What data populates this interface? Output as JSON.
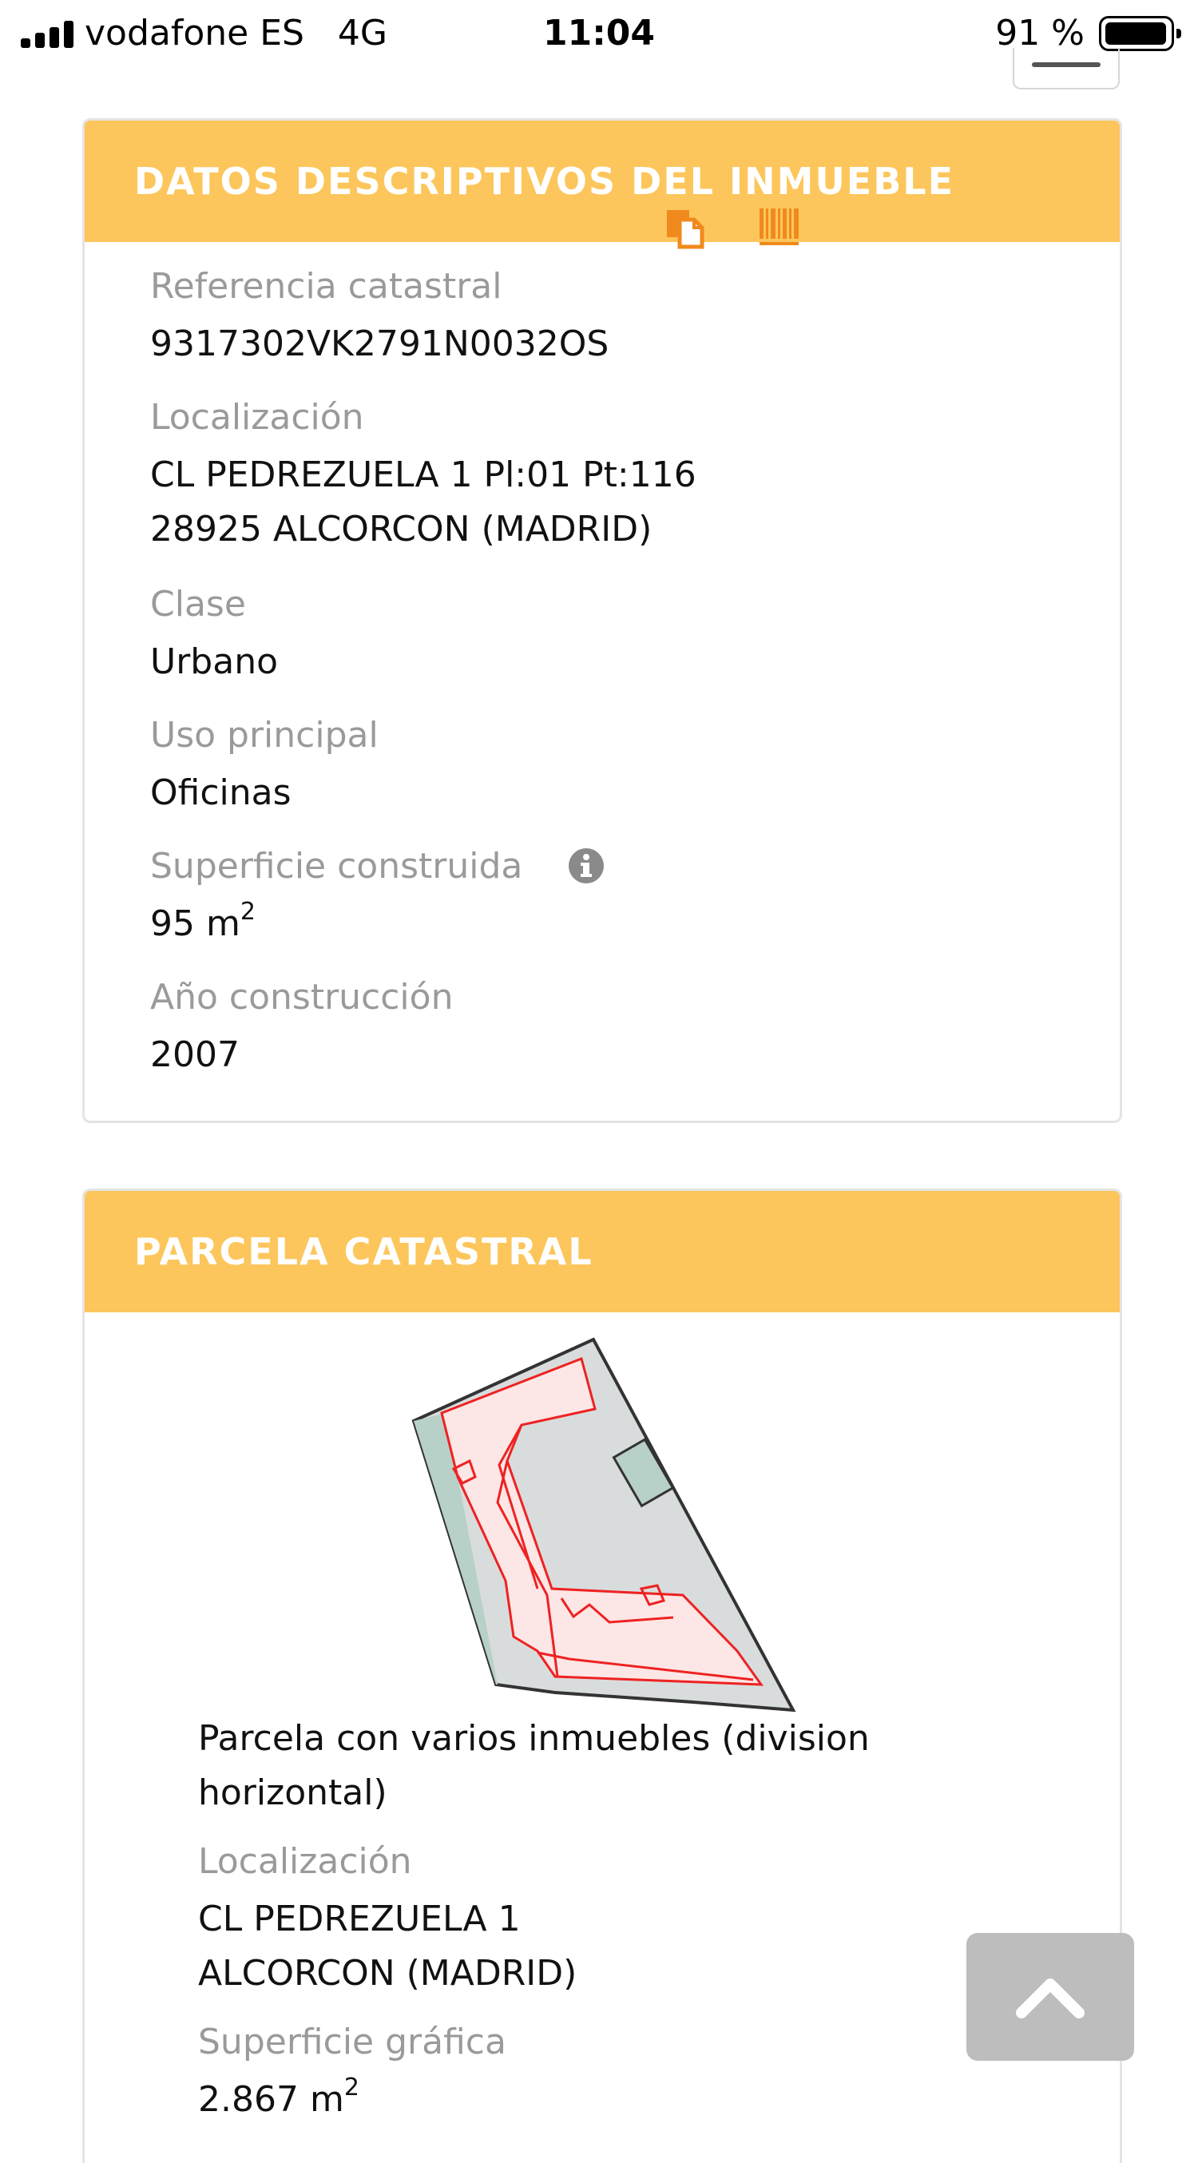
{
  "status_bar": {
    "carrier": "vodafone ES",
    "network": "4G",
    "time": "11:04",
    "battery": "91 %"
  },
  "descriptive": {
    "title": "DATOS DESCRIPTIVOS DEL INMUEBLE",
    "ref_label": "Referencia catastral",
    "ref_value": "9317302VK2791N0032OS",
    "loc_label": "Localización",
    "loc_line1": "CL PEDREZUELA 1 Pl:01 Pt:116",
    "loc_line2": "28925 ALCORCON (MADRID)",
    "class_label": "Clase",
    "class_value": "Urbano",
    "use_label": "Uso principal",
    "use_value": "Oficinas",
    "area_label": "Superficie construida",
    "area_value": "95 m",
    "area_exp": "2",
    "year_label": "Año construcción",
    "year_value": "2007"
  },
  "parcel": {
    "title": "PARCELA CATASTRAL",
    "desc_line1": "Parcela con varios inmuebles (division",
    "desc_line2": "horizontal)",
    "loc_label": "Localización",
    "loc_line1": "CL PEDREZUELA 1",
    "loc_line2": "ALCORCON (MADRID)",
    "area_label": "Superficie gráfica",
    "area_value": "2.867 m",
    "area_exp": "2"
  },
  "colors": {
    "header_bg": "#fcc65c",
    "icon_orange": "#f08a1c",
    "label_gray": "#9a9a9a"
  }
}
